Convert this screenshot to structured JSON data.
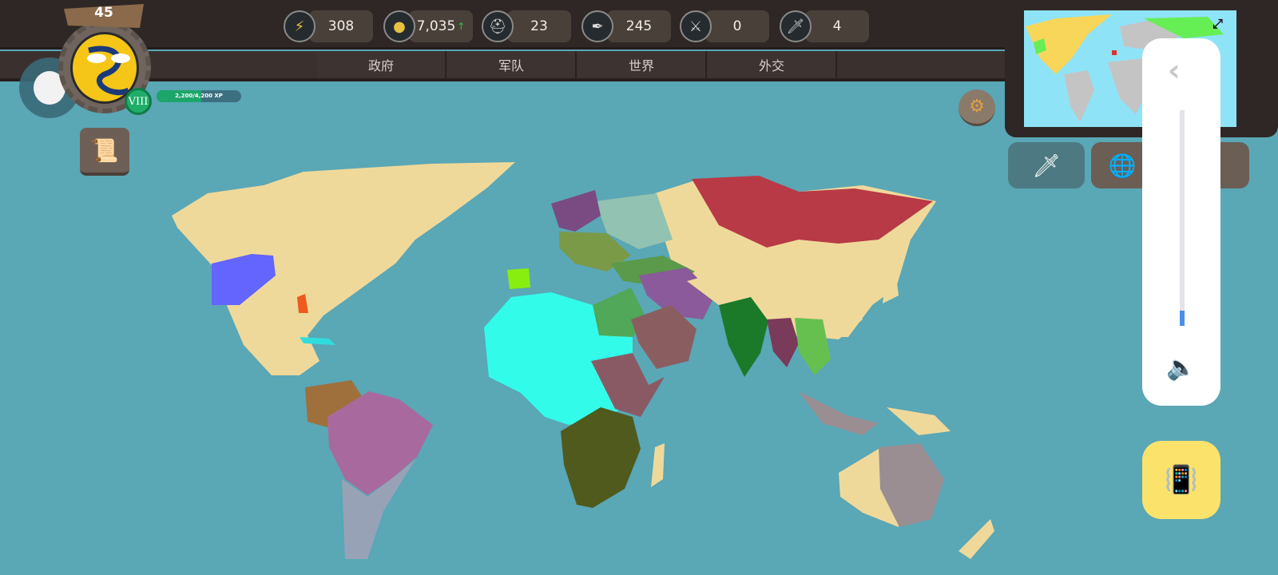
{
  "player": {
    "level_number": "45",
    "rank": "VIII",
    "xp_text": "2,200/4,200 XP",
    "xp_fraction": 0.524
  },
  "resources": [
    {
      "icon": "lightning-icon",
      "glyph": "⚡",
      "value": "308"
    },
    {
      "icon": "gold-coins-icon",
      "glyph": "●",
      "value": "7,035",
      "trend": "↑"
    },
    {
      "icon": "helmet-icon",
      "glyph": "⛑",
      "value": "23"
    },
    {
      "icon": "feather-icon",
      "glyph": "✒",
      "value": "245"
    },
    {
      "icon": "crossed-swords-icon",
      "glyph": "⚔",
      "value": "0"
    },
    {
      "icon": "sword-icon",
      "glyph": "🗡",
      "value": "4"
    }
  ],
  "tabs": [
    {
      "label": "政府"
    },
    {
      "label": "军队"
    },
    {
      "label": "世界"
    },
    {
      "label": "外交"
    }
  ],
  "colors": {
    "ocean": "#5aa7b6",
    "land": "#efd99a",
    "accent": "#fbe26b"
  },
  "volume": {
    "level": 0.07
  },
  "icons": {
    "chevron": "‹",
    "speaker": "🔈",
    "vibrate": "📳",
    "expand": "⤢",
    "sword": "🗡",
    "globe": "🌐",
    "gear": "⚙",
    "scroll": "📜"
  }
}
